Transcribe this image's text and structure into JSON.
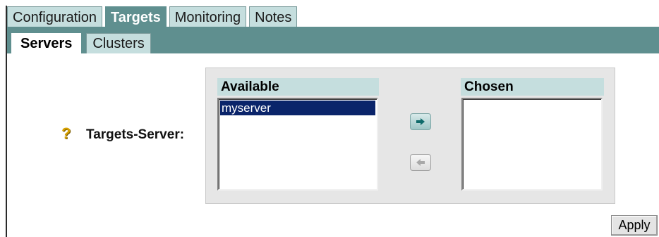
{
  "tabs_top": [
    {
      "label": "Configuration",
      "active": false
    },
    {
      "label": "Targets",
      "active": true
    },
    {
      "label": "Monitoring",
      "active": false
    },
    {
      "label": "Notes",
      "active": false
    }
  ],
  "tabs_sub": [
    {
      "label": "Servers",
      "active": true
    },
    {
      "label": "Clusters",
      "active": false
    }
  ],
  "field": {
    "help_icon": "question-mark-icon",
    "label": "Targets-Server:"
  },
  "shuttle": {
    "available_header": "Available",
    "chosen_header": "Chosen",
    "available_items": [
      "myserver"
    ],
    "selected_item": "myserver",
    "chosen_items": [],
    "move_right_icon": "arrow-right-icon",
    "move_left_icon": "arrow-left-icon"
  },
  "actions": {
    "apply_label": "Apply"
  },
  "colors": {
    "accent": "#5f8f8f",
    "tab_inactive": "#c5dede",
    "selection": "#0a246a",
    "help_icon": "#d6a000"
  }
}
